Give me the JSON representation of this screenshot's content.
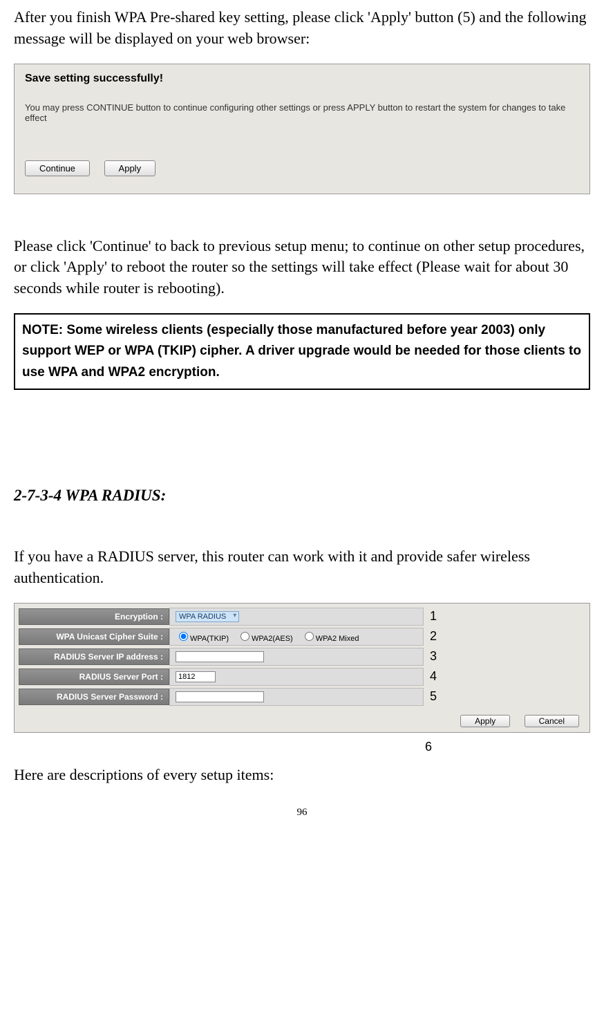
{
  "intro_paragraph": "After you finish WPA Pre-shared key setting, please click 'Apply' button (5) and the following message will be displayed on your web browser:",
  "screenshot1": {
    "title": "Save setting successfully!",
    "message": "You may press CONTINUE button to continue configuring other settings or press APPLY button to restart the system for changes to take effect",
    "continue_btn": "Continue",
    "apply_btn": "Apply"
  },
  "continue_paragraph": "Please click 'Continue' to back to previous setup menu; to continue on other setup procedures, or click 'Apply' to reboot the router so the settings will take effect (Please wait for about 30 seconds while router is rebooting).",
  "note_text": "NOTE: Some wireless clients (especially those manufactured before year 2003) only support WEP or WPA (TKIP) cipher. A driver upgrade would be needed for those clients to use WPA and WPA2 encryption.",
  "section_heading": "2-7-3-4 WPA RADIUS:",
  "radius_paragraph": "If you have a RADIUS server, this router can work with it and provide safer wireless authentication.",
  "form": {
    "encryption_label": "Encryption :",
    "encryption_value": "WPA RADIUS",
    "cipher_label": "WPA Unicast Cipher Suite :",
    "cipher_opt1": "WPA(TKIP)",
    "cipher_opt2": "WPA2(AES)",
    "cipher_opt3": "WPA2 Mixed",
    "ip_label": "RADIUS Server IP address :",
    "ip_value": "",
    "port_label": "RADIUS Server Port :",
    "port_value": "1812",
    "password_label": "RADIUS Server Password :",
    "password_value": "",
    "apply_btn": "Apply",
    "cancel_btn": "Cancel"
  },
  "numbers": {
    "n1": "1",
    "n2": "2",
    "n3": "3",
    "n4": "4",
    "n5": "5",
    "n6": "6"
  },
  "descriptions_text": "Here are descriptions of every setup items:",
  "page_number": "96"
}
